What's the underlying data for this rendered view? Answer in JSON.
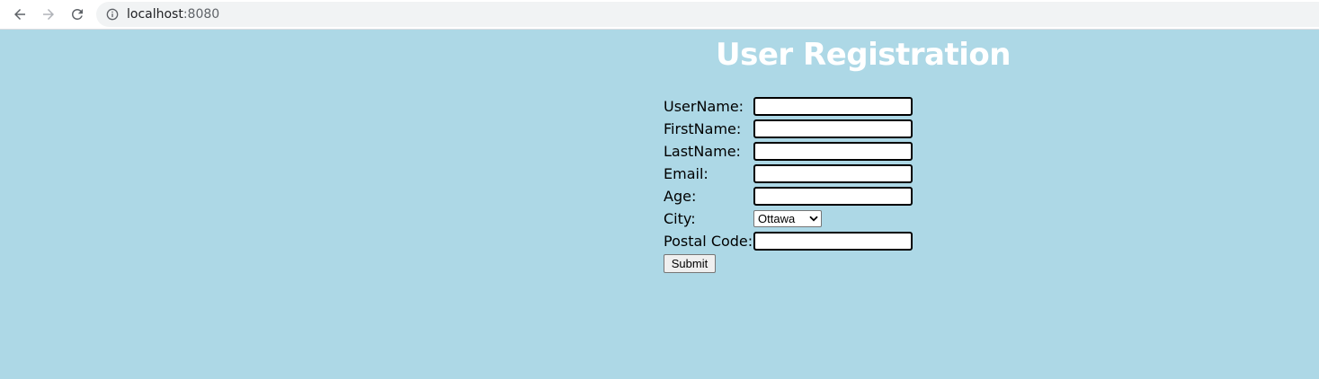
{
  "browser": {
    "url_host": "localhost",
    "url_port": ":8080",
    "icons": [
      "back-arrow-icon",
      "forward-arrow-icon",
      "reload-icon",
      "info-icon"
    ]
  },
  "page": {
    "background_color": "#add8e6",
    "title": "User Registration",
    "title_color": "#ffffff"
  },
  "form": {
    "username_label": "UserName:",
    "username_value": "",
    "firstname_label": "FirstName:",
    "firstname_value": "",
    "lastname_label": "LastName:",
    "lastname_value": "",
    "email_label": "Email:",
    "email_value": "",
    "age_label": "Age:",
    "age_value": "",
    "city_label": "City:",
    "city_selected": "Ottawa",
    "postal_code_label": "Postal Code:",
    "postal_code_value": "",
    "submit_label": "Submit"
  }
}
